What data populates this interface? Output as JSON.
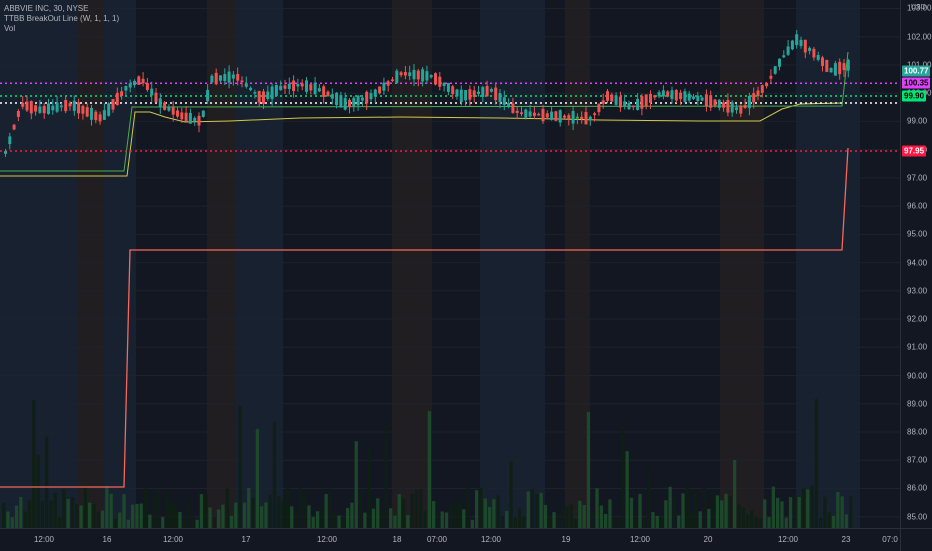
{
  "legend": {
    "symbol_line": "ABBVIE INC, 30, NYSE",
    "indicator_line": "TTBB BreakOut Line (W, 1, 1, 1)",
    "volume_line": "Vol"
  },
  "price_axis": {
    "currency": "USD",
    "ticks": [
      "103.00",
      "102.00",
      "101.00",
      "100.00",
      "99.00",
      "98.00",
      "97.00",
      "96.00",
      "95.00",
      "94.00",
      "93.00",
      "92.00",
      "91.00",
      "90.00",
      "89.00",
      "88.00",
      "87.00",
      "86.00",
      "85.00"
    ]
  },
  "price_labels": [
    {
      "text": "100.77",
      "value": 100.77,
      "color": "#26a69a"
    },
    {
      "text": "100.35",
      "value": 100.35,
      "color": "#e040fb"
    },
    {
      "text": "99.90",
      "value": 99.9,
      "color": "#00e676"
    },
    {
      "text": "97.95",
      "value": 97.95,
      "color": "#ff1744"
    }
  ],
  "time_axis": {
    "labels": [
      "12:00",
      "16",
      "12:00",
      "17",
      "12:00",
      "18",
      "07:00",
      "12:00",
      "19",
      "12:00",
      "20",
      "12:00",
      "23",
      "07:0"
    ]
  },
  "chart_data": {
    "type": "candlestick",
    "title": "ABBVIE INC, 30, NYSE",
    "ylim": [
      84.6,
      103.3
    ],
    "horizontal_levels": [
      {
        "name": "magenta-level",
        "value": 100.35,
        "color": "#e040fb",
        "style": "dotted"
      },
      {
        "name": "green-level",
        "value": 99.9,
        "color": "#00e676",
        "style": "dotted"
      },
      {
        "name": "white-level",
        "value": 99.65,
        "color": "#ffffff",
        "style": "dotted"
      },
      {
        "name": "red-level",
        "value": 97.95,
        "color": "#ff1744",
        "style": "dotted"
      }
    ],
    "colors": {
      "up": "#26a69a",
      "down": "#ef5350",
      "breakout_red": "#f7675c",
      "breakout_yellow": "#d4c84a",
      "breakout_green": "#4caf50"
    },
    "session_bands": [
      "#1c2a3a",
      "#2b2520",
      "#1c2a3a",
      "#2b2520"
    ]
  }
}
